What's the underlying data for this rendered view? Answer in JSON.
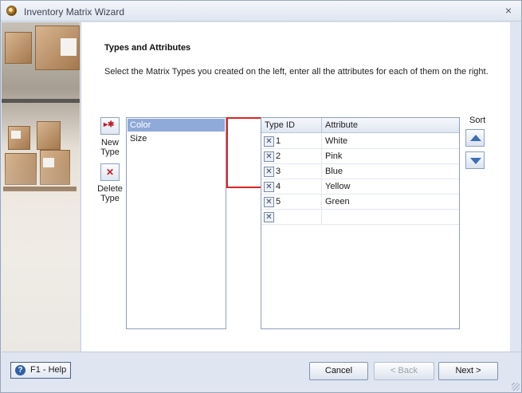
{
  "window": {
    "title": "Inventory Matrix Wizard",
    "close_glyph": "×",
    "app_icon": "app-icon",
    "side_image": "warehouse-boxes-photo"
  },
  "page": {
    "heading": "Types and Attributes",
    "instructions": "Select the Matrix Types you created on the left, enter all the attributes for each of them on the right."
  },
  "toolbar": {
    "new_type_label_1": "New",
    "new_type_label_2": "Type",
    "delete_type_label_1": "Delete",
    "delete_type_label_2": "Type",
    "new_icon_glyph": "▸✱",
    "delete_icon_glyph": "✕"
  },
  "types": {
    "items": [
      "Color",
      "Size"
    ],
    "selected": "Color"
  },
  "grid": {
    "headers": [
      "Type ID",
      "Attribute"
    ],
    "delete_glyph": "✕",
    "rows": [
      {
        "id": "1",
        "attribute": "White"
      },
      {
        "id": "2",
        "attribute": "Pink"
      },
      {
        "id": "3",
        "attribute": "Blue"
      },
      {
        "id": "4",
        "attribute": "Yellow"
      },
      {
        "id": "5",
        "attribute": "Green"
      },
      {
        "id": "",
        "attribute": ""
      }
    ]
  },
  "sort": {
    "label": "Sort",
    "up_icon": "triangle-up-icon",
    "down_icon": "triangle-down-icon"
  },
  "footer": {
    "help_label": "F1 - Help",
    "help_glyph": "?",
    "cancel_label": "Cancel",
    "back_label": "< Back",
    "next_label": "Next >"
  },
  "colors": {
    "selection": "#8fa9d8",
    "highlight_border": "#e22222",
    "accent": "#3c6fb3"
  }
}
